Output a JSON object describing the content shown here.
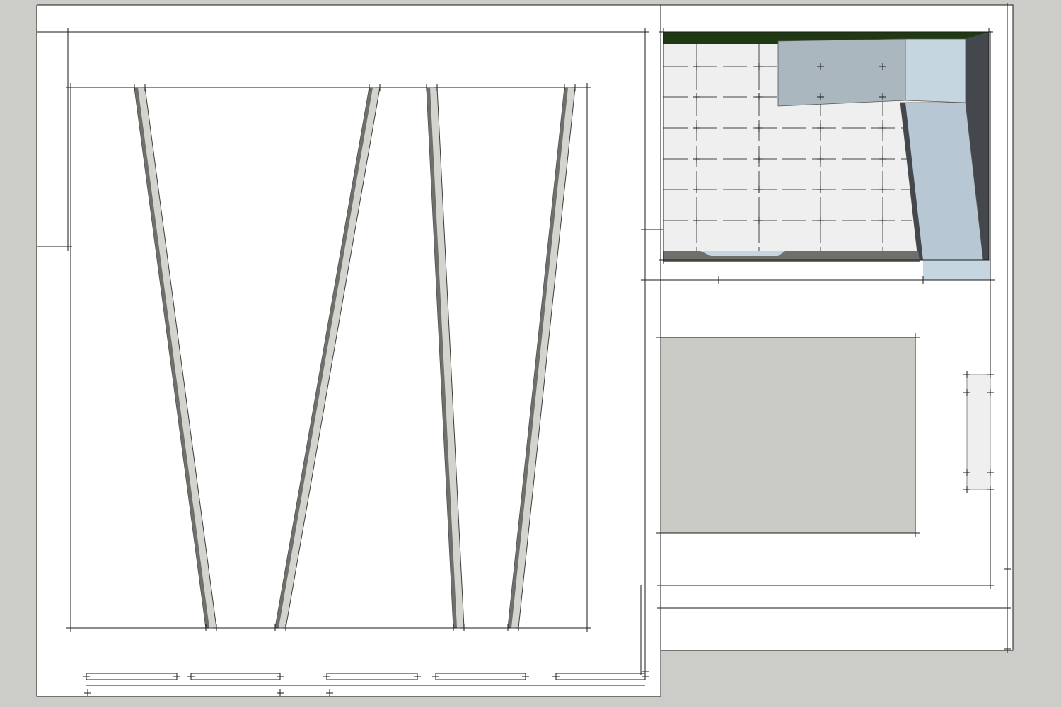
{
  "colors": {
    "background": "#ccccc8",
    "paper": "#ffffff",
    "line": "#1a1a1a",
    "panel_light": "#d4d4cf",
    "panel_dark": "#6f6f6b",
    "panel_edge": "#3c3c3a",
    "grid_fill": "#efefef",
    "blue_gray": "#aab7bf",
    "blue_light": "#c6d6e1",
    "blue_mid": "#b7c7d3",
    "dark_side": "#44484c",
    "dark_green": "#1f3a12",
    "gray_rect": "#cbcbc6"
  },
  "diagram": {
    "labels": []
  }
}
